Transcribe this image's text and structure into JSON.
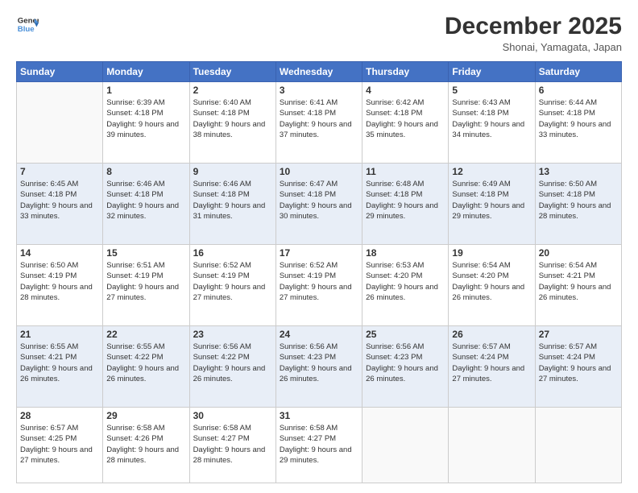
{
  "logo": {
    "line1": "General",
    "line2": "Blue"
  },
  "title": "December 2025",
  "location": "Shonai, Yamagata, Japan",
  "days_of_week": [
    "Sunday",
    "Monday",
    "Tuesday",
    "Wednesday",
    "Thursday",
    "Friday",
    "Saturday"
  ],
  "weeks": [
    [
      {
        "day": "",
        "sunrise": "",
        "sunset": "",
        "daylight": ""
      },
      {
        "day": "1",
        "sunrise": "Sunrise: 6:39 AM",
        "sunset": "Sunset: 4:18 PM",
        "daylight": "Daylight: 9 hours and 39 minutes."
      },
      {
        "day": "2",
        "sunrise": "Sunrise: 6:40 AM",
        "sunset": "Sunset: 4:18 PM",
        "daylight": "Daylight: 9 hours and 38 minutes."
      },
      {
        "day": "3",
        "sunrise": "Sunrise: 6:41 AM",
        "sunset": "Sunset: 4:18 PM",
        "daylight": "Daylight: 9 hours and 37 minutes."
      },
      {
        "day": "4",
        "sunrise": "Sunrise: 6:42 AM",
        "sunset": "Sunset: 4:18 PM",
        "daylight": "Daylight: 9 hours and 35 minutes."
      },
      {
        "day": "5",
        "sunrise": "Sunrise: 6:43 AM",
        "sunset": "Sunset: 4:18 PM",
        "daylight": "Daylight: 9 hours and 34 minutes."
      },
      {
        "day": "6",
        "sunrise": "Sunrise: 6:44 AM",
        "sunset": "Sunset: 4:18 PM",
        "daylight": "Daylight: 9 hours and 33 minutes."
      }
    ],
    [
      {
        "day": "7",
        "sunrise": "Sunrise: 6:45 AM",
        "sunset": "Sunset: 4:18 PM",
        "daylight": "Daylight: 9 hours and 33 minutes."
      },
      {
        "day": "8",
        "sunrise": "Sunrise: 6:46 AM",
        "sunset": "Sunset: 4:18 PM",
        "daylight": "Daylight: 9 hours and 32 minutes."
      },
      {
        "day": "9",
        "sunrise": "Sunrise: 6:46 AM",
        "sunset": "Sunset: 4:18 PM",
        "daylight": "Daylight: 9 hours and 31 minutes."
      },
      {
        "day": "10",
        "sunrise": "Sunrise: 6:47 AM",
        "sunset": "Sunset: 4:18 PM",
        "daylight": "Daylight: 9 hours and 30 minutes."
      },
      {
        "day": "11",
        "sunrise": "Sunrise: 6:48 AM",
        "sunset": "Sunset: 4:18 PM",
        "daylight": "Daylight: 9 hours and 29 minutes."
      },
      {
        "day": "12",
        "sunrise": "Sunrise: 6:49 AM",
        "sunset": "Sunset: 4:18 PM",
        "daylight": "Daylight: 9 hours and 29 minutes."
      },
      {
        "day": "13",
        "sunrise": "Sunrise: 6:50 AM",
        "sunset": "Sunset: 4:18 PM",
        "daylight": "Daylight: 9 hours and 28 minutes."
      }
    ],
    [
      {
        "day": "14",
        "sunrise": "Sunrise: 6:50 AM",
        "sunset": "Sunset: 4:19 PM",
        "daylight": "Daylight: 9 hours and 28 minutes."
      },
      {
        "day": "15",
        "sunrise": "Sunrise: 6:51 AM",
        "sunset": "Sunset: 4:19 PM",
        "daylight": "Daylight: 9 hours and 27 minutes."
      },
      {
        "day": "16",
        "sunrise": "Sunrise: 6:52 AM",
        "sunset": "Sunset: 4:19 PM",
        "daylight": "Daylight: 9 hours and 27 minutes."
      },
      {
        "day": "17",
        "sunrise": "Sunrise: 6:52 AM",
        "sunset": "Sunset: 4:19 PM",
        "daylight": "Daylight: 9 hours and 27 minutes."
      },
      {
        "day": "18",
        "sunrise": "Sunrise: 6:53 AM",
        "sunset": "Sunset: 4:20 PM",
        "daylight": "Daylight: 9 hours and 26 minutes."
      },
      {
        "day": "19",
        "sunrise": "Sunrise: 6:54 AM",
        "sunset": "Sunset: 4:20 PM",
        "daylight": "Daylight: 9 hours and 26 minutes."
      },
      {
        "day": "20",
        "sunrise": "Sunrise: 6:54 AM",
        "sunset": "Sunset: 4:21 PM",
        "daylight": "Daylight: 9 hours and 26 minutes."
      }
    ],
    [
      {
        "day": "21",
        "sunrise": "Sunrise: 6:55 AM",
        "sunset": "Sunset: 4:21 PM",
        "daylight": "Daylight: 9 hours and 26 minutes."
      },
      {
        "day": "22",
        "sunrise": "Sunrise: 6:55 AM",
        "sunset": "Sunset: 4:22 PM",
        "daylight": "Daylight: 9 hours and 26 minutes."
      },
      {
        "day": "23",
        "sunrise": "Sunrise: 6:56 AM",
        "sunset": "Sunset: 4:22 PM",
        "daylight": "Daylight: 9 hours and 26 minutes."
      },
      {
        "day": "24",
        "sunrise": "Sunrise: 6:56 AM",
        "sunset": "Sunset: 4:23 PM",
        "daylight": "Daylight: 9 hours and 26 minutes."
      },
      {
        "day": "25",
        "sunrise": "Sunrise: 6:56 AM",
        "sunset": "Sunset: 4:23 PM",
        "daylight": "Daylight: 9 hours and 26 minutes."
      },
      {
        "day": "26",
        "sunrise": "Sunrise: 6:57 AM",
        "sunset": "Sunset: 4:24 PM",
        "daylight": "Daylight: 9 hours and 27 minutes."
      },
      {
        "day": "27",
        "sunrise": "Sunrise: 6:57 AM",
        "sunset": "Sunset: 4:24 PM",
        "daylight": "Daylight: 9 hours and 27 minutes."
      }
    ],
    [
      {
        "day": "28",
        "sunrise": "Sunrise: 6:57 AM",
        "sunset": "Sunset: 4:25 PM",
        "daylight": "Daylight: 9 hours and 27 minutes."
      },
      {
        "day": "29",
        "sunrise": "Sunrise: 6:58 AM",
        "sunset": "Sunset: 4:26 PM",
        "daylight": "Daylight: 9 hours and 28 minutes."
      },
      {
        "day": "30",
        "sunrise": "Sunrise: 6:58 AM",
        "sunset": "Sunset: 4:27 PM",
        "daylight": "Daylight: 9 hours and 28 minutes."
      },
      {
        "day": "31",
        "sunrise": "Sunrise: 6:58 AM",
        "sunset": "Sunset: 4:27 PM",
        "daylight": "Daylight: 9 hours and 29 minutes."
      },
      {
        "day": "",
        "sunrise": "",
        "sunset": "",
        "daylight": ""
      },
      {
        "day": "",
        "sunrise": "",
        "sunset": "",
        "daylight": ""
      },
      {
        "day": "",
        "sunrise": "",
        "sunset": "",
        "daylight": ""
      }
    ]
  ]
}
